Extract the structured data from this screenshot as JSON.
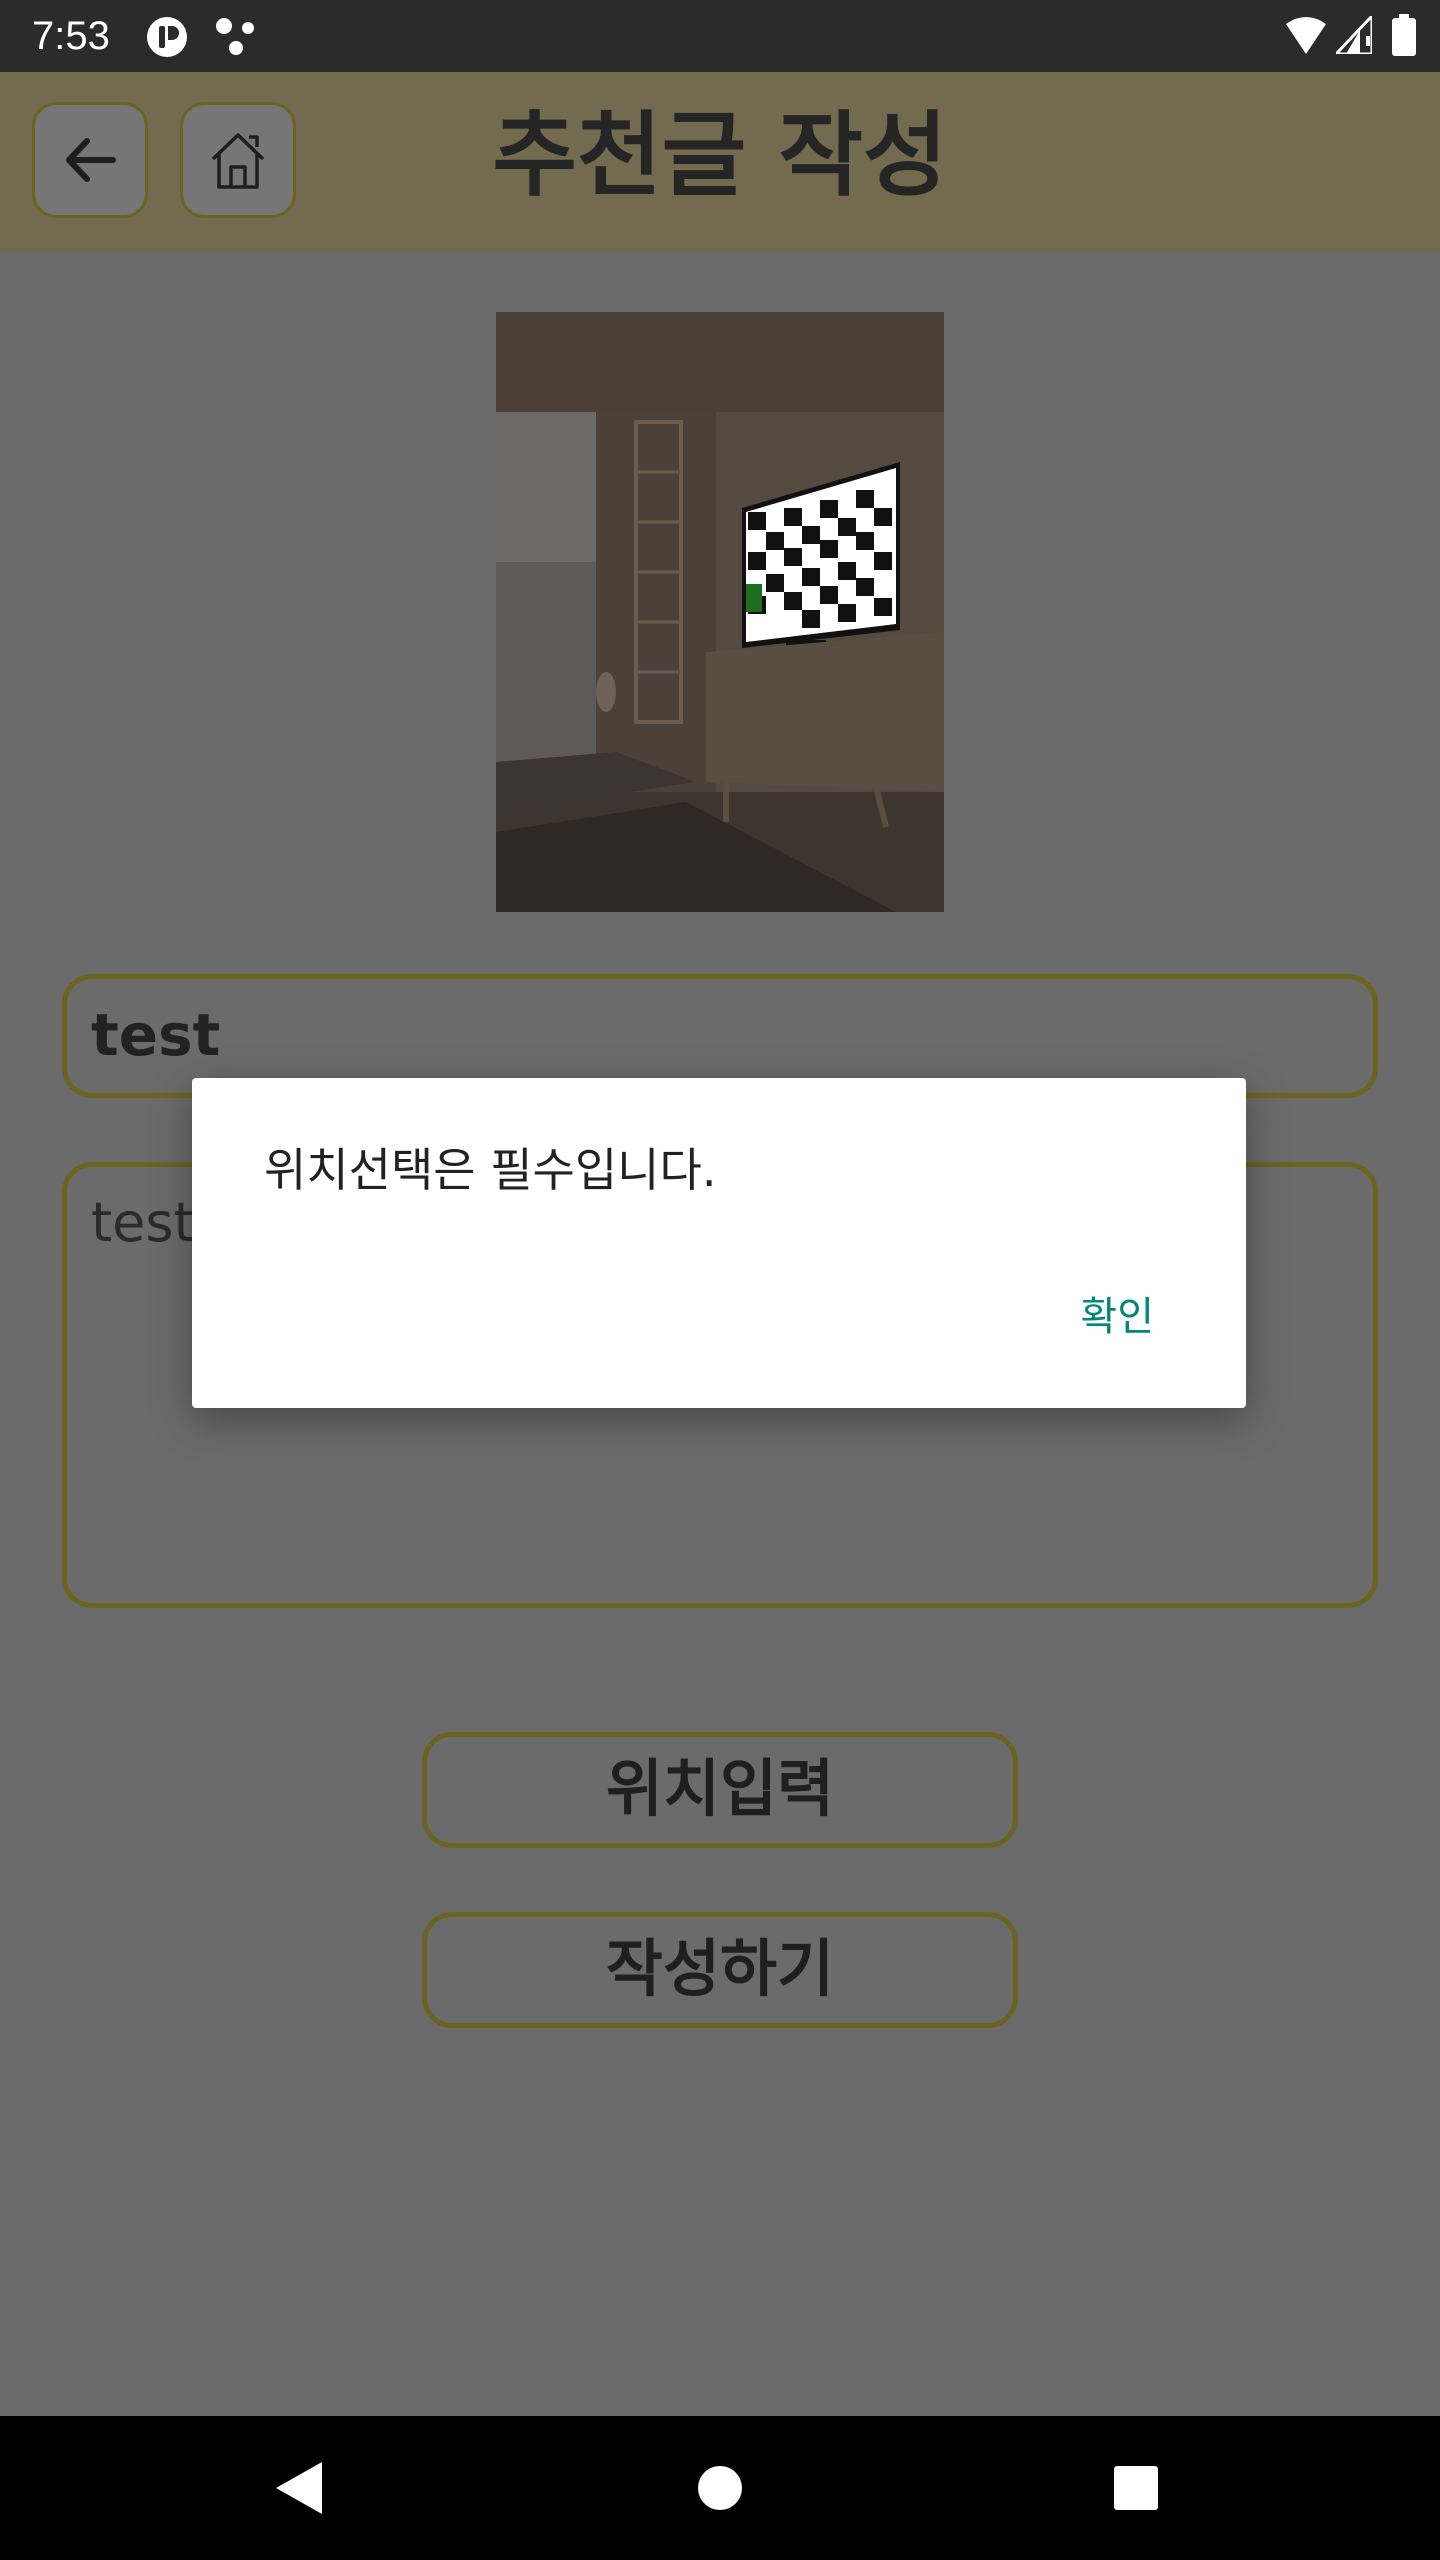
{
  "status_bar": {
    "time": "7:53",
    "icons": [
      "app-notification-icon",
      "dots-icon",
      "wifi-icon",
      "signal-icon",
      "battery-icon"
    ]
  },
  "app_bar": {
    "title": "추천글 작성",
    "back_icon": "arrow-left-icon",
    "home_icon": "home-icon"
  },
  "form": {
    "title_value": "test",
    "body_value": "test",
    "location_button_label": "위치입력",
    "submit_button_label": "작성하기"
  },
  "dialog": {
    "message": "위치선택은 필수입니다.",
    "confirm_label": "확인"
  },
  "nav_bar": {
    "icons": [
      "back-triangle-icon",
      "home-circle-icon",
      "recents-square-icon"
    ]
  },
  "colors": {
    "accent": "#00867a",
    "border": "#c9b41e",
    "app_bar_bg": "#f4e7b4",
    "scrim": "rgba(0,0,0,0.55)"
  }
}
